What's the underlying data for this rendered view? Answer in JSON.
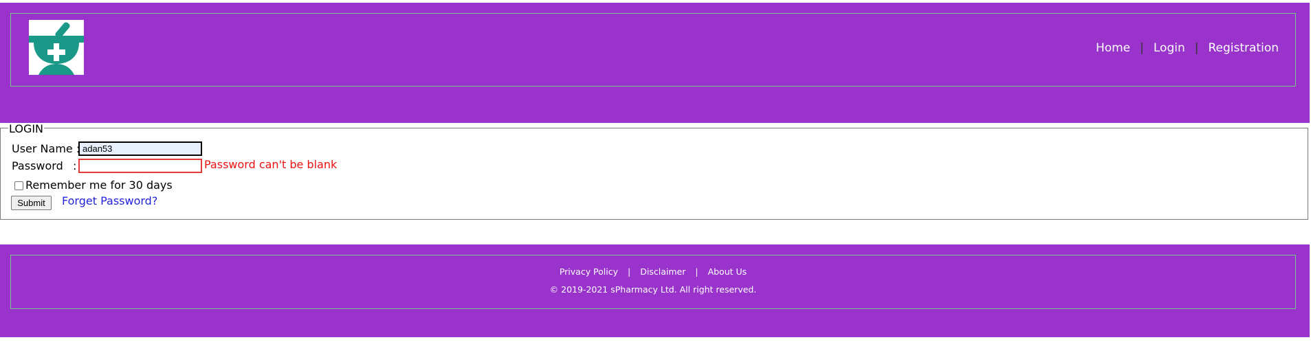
{
  "header": {
    "logo_icon": "pharmacy-mortar-pestle-cross-logo",
    "nav": {
      "home": "Home",
      "login": "Login",
      "registration": "Registration",
      "separator": "|"
    }
  },
  "login": {
    "legend": "LOGIN",
    "username_label": "User Name :",
    "username_value": "adan53",
    "password_label": "Password",
    "password_colon": ":",
    "password_value": "",
    "password_error": "Password can't be blank",
    "remember_label": "Remember me for 30 days",
    "remember_checked": false,
    "submit_label": "Submit",
    "forget_label": "Forget Password?"
  },
  "footer": {
    "privacy": "Privacy Policy",
    "disclaimer": "Disclaimer",
    "about": "About Us",
    "separator": "|",
    "copyright": "© 2019-2021 sPharmacy Ltd. All right reserved."
  },
  "colors": {
    "brand_purple": "#9933cc",
    "logo_teal": "#1a9988",
    "error_red": "#ee1111",
    "link_blue": "#2222dd",
    "frame_green": "#77c98a"
  }
}
